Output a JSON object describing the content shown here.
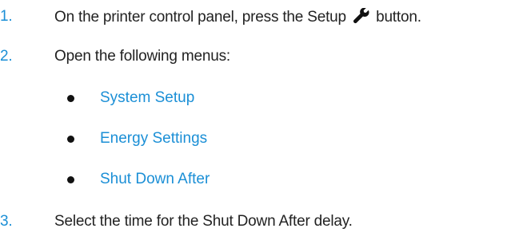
{
  "steps": [
    {
      "number": "1.",
      "text_before_icon": "On the printer control panel, press the Setup",
      "icon": "wrench-icon",
      "text_after_icon": " button."
    },
    {
      "number": "2.",
      "text": "Open the following menus:"
    },
    {
      "number": "3.",
      "text": "Select the time for the Shut Down After delay."
    }
  ],
  "menus": [
    {
      "label": "System Setup"
    },
    {
      "label": "Energy Settings"
    },
    {
      "label": "Shut Down After"
    }
  ],
  "colors": {
    "accent": "#1b8fd6",
    "text": "#222222",
    "bullet": "#111111"
  }
}
